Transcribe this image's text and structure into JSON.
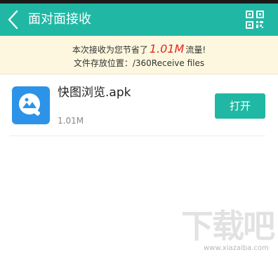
{
  "header": {
    "title": "面对面接收",
    "back_icon": "chevron-left-icon",
    "qr_icon": "qr-code-icon",
    "color": "#20b8a4"
  },
  "notice": {
    "prefix": "本次接收为您节省了",
    "saved_amount": "1.01M",
    "suffix": "流量!",
    "path_line": "文件存放位置：/360Receive files",
    "background": "#fcf7de",
    "highlight_color": "#e8251d"
  },
  "files": [
    {
      "name": "快图浏览.apk",
      "size": "1.01M",
      "icon": "photo-viewer-app-icon",
      "action_label": "打开"
    }
  ],
  "watermark": {
    "logo_text": "下载吧",
    "url": "www.xiazaiba.com"
  }
}
